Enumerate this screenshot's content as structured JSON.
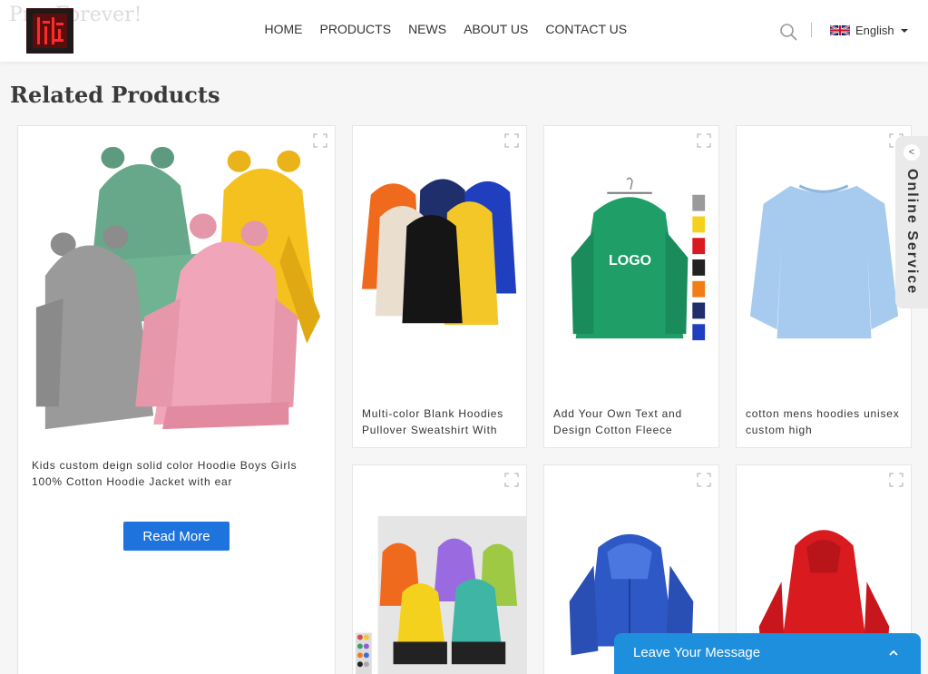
{
  "header": {
    "ghost_slogan": "Pr... Forever!",
    "nav": [
      "HOME",
      "PRODUCTS",
      "NEWS",
      "ABOUT US",
      "CONTACT US"
    ],
    "language": "English"
  },
  "section_title": "Related Products",
  "featured": {
    "name": "Kids custom deign solid color Hoodie Boys Girls 100% Cotton Hoodie Jacket with ear",
    "button": "Read More"
  },
  "products": [
    {
      "name": "Multi-color Blank Hoodies Pullover Sweatshirt With"
    },
    {
      "name": "Add Your Own Text and Design Cotton Fleece",
      "logo_text": "LOGO"
    },
    {
      "name": "cotton mens hoodies unisex custom high"
    }
  ],
  "online_service": "Online Service",
  "leave_message": "Leave Your Message",
  "colors": {
    "accent_blue": "#1e73dc",
    "message_blue": "#1e8fdc",
    "hoodie_green": "#1f9e68",
    "hoodie_lightblue": "#a6cbef",
    "hoodie_red": "#d91a1f",
    "hoodie_royal": "#2e58c6"
  }
}
